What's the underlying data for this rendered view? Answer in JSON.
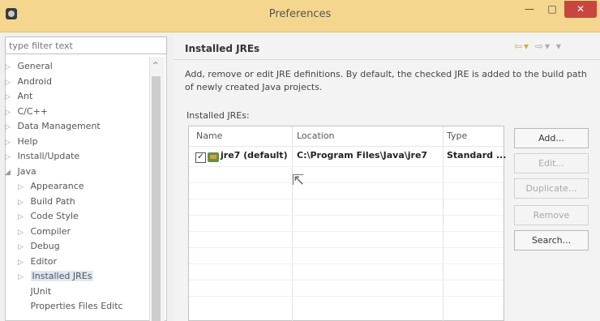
{
  "window": {
    "title": "Preferences"
  },
  "filter": {
    "placeholder": "type filter text"
  },
  "tree": {
    "items": [
      {
        "label": "General",
        "expanded": false
      },
      {
        "label": "Android",
        "expanded": false
      },
      {
        "label": "Ant",
        "expanded": false
      },
      {
        "label": "C/C++",
        "expanded": false
      },
      {
        "label": "Data Management",
        "expanded": false
      },
      {
        "label": "Help",
        "expanded": false
      },
      {
        "label": "Install/Update",
        "expanded": false
      },
      {
        "label": "Java",
        "expanded": true
      }
    ],
    "java_children": [
      "Appearance",
      "Build Path",
      "Code Style",
      "Compiler",
      "Debug",
      "Editor",
      "Installed JREs",
      "JUnit",
      "Properties Files Editc"
    ]
  },
  "page": {
    "title": "Installed JREs",
    "description": "Add, remove or edit JRE definitions. By default, the checked JRE is added to the build path of newly created Java projects.",
    "table_label": "Installed JREs:"
  },
  "table": {
    "columns": [
      "Name",
      "Location",
      "Type"
    ],
    "rows": [
      {
        "checked": true,
        "name": "jre7 (default)",
        "location": "C:\\Program Files\\Java\\jre7",
        "type": "Standard ..."
      }
    ]
  },
  "buttons": {
    "add": "Add...",
    "edit": "Edit...",
    "duplicate": "Duplicate...",
    "remove": "Remove",
    "search": "Search..."
  },
  "colors": {
    "titlebar": "#f5d68f",
    "close_button": "#c9453f",
    "selection": "#dfe7f3"
  }
}
